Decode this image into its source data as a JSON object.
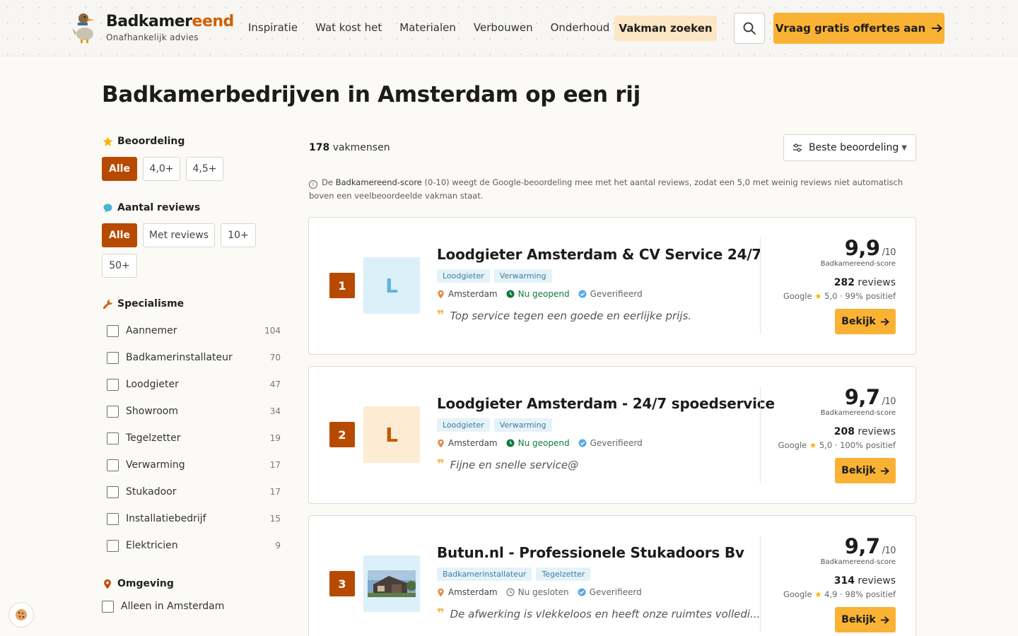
{
  "header": {
    "logo_name_1": "Badkamer",
    "logo_name_2": "eend",
    "logo_sub": "Onafhankelijk advies",
    "nav": [
      "Inspiratie",
      "Wat kost het",
      "Materialen",
      "Verbouwen",
      "Onderhoud"
    ],
    "vakman": "Vakman zoeken",
    "offerte": "Vraag gratis offertes aan",
    "accent": "#f9b233"
  },
  "page": {
    "title": "Badkamerbedrijven in Amsterdam op een rij"
  },
  "filters": {
    "rating": {
      "label": "Beoordeling",
      "options": [
        "Alle",
        "4,0+",
        "4,5+"
      ],
      "selected": "Alle"
    },
    "reviews": {
      "label": "Aantal reviews",
      "options": [
        "Alle",
        "Met reviews",
        "10+",
        "50+"
      ],
      "selected": "Alle"
    },
    "specialism": {
      "label": "Specialisme",
      "items": [
        {
          "name": "Aannemer",
          "count": "104"
        },
        {
          "name": "Badkamerinstallateur",
          "count": "70"
        },
        {
          "name": "Loodgieter",
          "count": "47"
        },
        {
          "name": "Showroom",
          "count": "34"
        },
        {
          "name": "Tegelzetter",
          "count": "19"
        },
        {
          "name": "Verwarming",
          "count": "17"
        },
        {
          "name": "Stukadoor",
          "count": "17"
        },
        {
          "name": "Installatiebedrijf",
          "count": "15"
        },
        {
          "name": "Elektricien",
          "count": "9"
        }
      ]
    },
    "area": {
      "label": "Omgeving",
      "option": "Alleen in Amsterdam"
    }
  },
  "results": {
    "count_num": "178",
    "count_label": "vakmensen",
    "sort": "Beste beoordeling",
    "info_pre": "De",
    "info_brand": "Badkamereend-score",
    "info_post": "(0-10) weegt de Google-beoordeling mee met het aantal reviews, zodat een 5,0 met weinig reviews niet automatisch boven een veelbeoordeelde vakman staat.",
    "cards": [
      {
        "rank": "1",
        "avatar": "L",
        "title": "Loodgieter Amsterdam & CV Service 24/7",
        "tags": [
          "Loodgieter",
          "Verwarming"
        ],
        "city": "Amsterdam",
        "status": "Nu geopend",
        "verified": "Geverifieerd",
        "quote": "Top service tegen een goede en eerlijke prijs.",
        "score": "9,9",
        "score_of": "/10",
        "score_label": "Badkamereend-score",
        "reviews_num": "282",
        "reviews_label": "reviews",
        "google": "Google",
        "google_rating": "5,0 · 99% positief",
        "button": "Bekijk"
      },
      {
        "rank": "2",
        "avatar": "L",
        "title": "Loodgieter Amsterdam - 24/7 spoedservice",
        "tags": [
          "Loodgieter",
          "Verwarming"
        ],
        "city": "Amsterdam",
        "status": "Nu geopend",
        "verified": "Geverifieerd",
        "quote": "Fijne en snelle service@",
        "score": "9,7",
        "score_of": "/10",
        "score_label": "Badkamereend-score",
        "reviews_num": "208",
        "reviews_label": "reviews",
        "google": "Google",
        "google_rating": "5,0 · 100% positief",
        "button": "Bekijk"
      },
      {
        "rank": "3",
        "avatar": "",
        "title": "Butun.nl - Professionele Stukadoors Bv",
        "tags": [
          "Badkamerinstallateur",
          "Tegelzetter"
        ],
        "city": "Amsterdam",
        "status": "Nu gesloten",
        "verified": "Geverifieerd",
        "quote": "De afwerking is vlekkeloos en heeft onze ruimtes volledi...",
        "score": "9,7",
        "score_of": "/10",
        "score_label": "Badkamereend-score",
        "reviews_num": "314",
        "reviews_label": "reviews",
        "google": "Google",
        "google_rating": "4,9 · 98% positief",
        "button": "Bekijk"
      }
    ]
  }
}
